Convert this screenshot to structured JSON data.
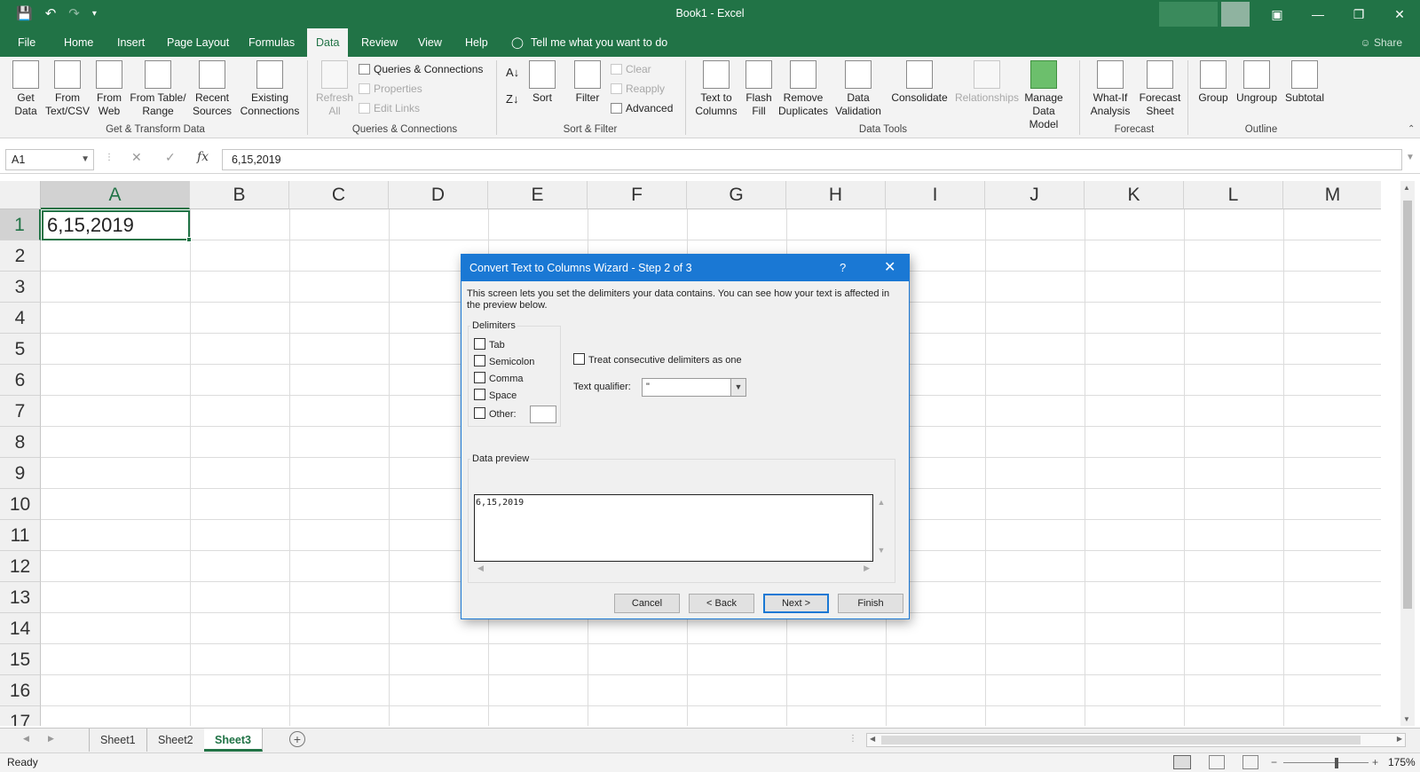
{
  "window": {
    "title": "Book1  -  Excel"
  },
  "ribbon_tabs": [
    {
      "label": "File"
    },
    {
      "label": "Home"
    },
    {
      "label": "Insert"
    },
    {
      "label": "Page Layout"
    },
    {
      "label": "Formulas"
    },
    {
      "label": "Data"
    },
    {
      "label": "Review"
    },
    {
      "label": "View"
    },
    {
      "label": "Help"
    }
  ],
  "tell_me": "Tell me what you want to do",
  "share_label": "Share",
  "ribbon": {
    "get_transform": {
      "label": "Get & Transform Data",
      "get_data": "Get\nData",
      "from_text": "From\nText/CSV",
      "from_web": "From\nWeb",
      "from_table": "From Table/\nRange",
      "recent_sources": "Recent\nSources",
      "existing_connections": "Existing\nConnections"
    },
    "queries": {
      "label": "Queries & Connections",
      "refresh_all": "Refresh\nAll",
      "queries_connections": "Queries & Connections",
      "properties": "Properties",
      "edit_links": "Edit Links"
    },
    "sort_filter": {
      "label": "Sort & Filter",
      "sort": "Sort",
      "filter": "Filter",
      "clear": "Clear",
      "reapply": "Reapply",
      "advanced": "Advanced"
    },
    "data_tools": {
      "label": "Data Tools",
      "text_to_columns": "Text to\nColumns",
      "flash_fill": "Flash\nFill",
      "remove_duplicates": "Remove\nDuplicates",
      "data_validation": "Data\nValidation",
      "consolidate": "Consolidate",
      "relationships": "Relationships",
      "manage_data_model": "Manage\nData Model"
    },
    "forecast": {
      "label": "Forecast",
      "what_if": "What-If\nAnalysis",
      "forecast_sheet": "Forecast\nSheet"
    },
    "outline": {
      "label": "Outline",
      "group": "Group",
      "ungroup": "Ungroup",
      "subtotal": "Subtotal"
    }
  },
  "formula_bar": {
    "name_box": "A1",
    "formula": "6,15,2019"
  },
  "grid": {
    "columns": [
      "A",
      "B",
      "C",
      "D",
      "E",
      "F",
      "G",
      "H",
      "I",
      "J",
      "K",
      "L",
      "M"
    ],
    "rows": [
      "1",
      "2",
      "3",
      "4",
      "5",
      "6",
      "7",
      "8",
      "9",
      "10",
      "11",
      "12",
      "13",
      "14",
      "15",
      "16",
      "17"
    ],
    "cell_a1": "6,15,2019"
  },
  "sheets": [
    {
      "label": "Sheet1"
    },
    {
      "label": "Sheet2"
    },
    {
      "label": "Sheet3"
    }
  ],
  "status": {
    "ready": "Ready",
    "zoom": "175%"
  },
  "dialog": {
    "title": "Convert Text to Columns Wizard - Step 2 of 3",
    "help": "?",
    "description": "This screen lets you set the delimiters your data contains.  You can see how your text is affected in the preview below.",
    "delimiters_label": "Delimiters",
    "tab": "Tab",
    "semicolon": "Semicolon",
    "comma": "Comma",
    "space": "Space",
    "other": "Other:",
    "treat_consecutive": "Treat consecutive delimiters as one",
    "text_qualifier_label": "Text qualifier:",
    "text_qualifier_value": "\"",
    "data_preview_label": "Data preview",
    "preview_text": "6,15,2019",
    "buttons": {
      "cancel": "Cancel",
      "back": "< Back",
      "next": "Next >",
      "finish": "Finish"
    }
  },
  "colors": {
    "excel_green": "#217346",
    "dialog_blue": "#1a78d4"
  }
}
